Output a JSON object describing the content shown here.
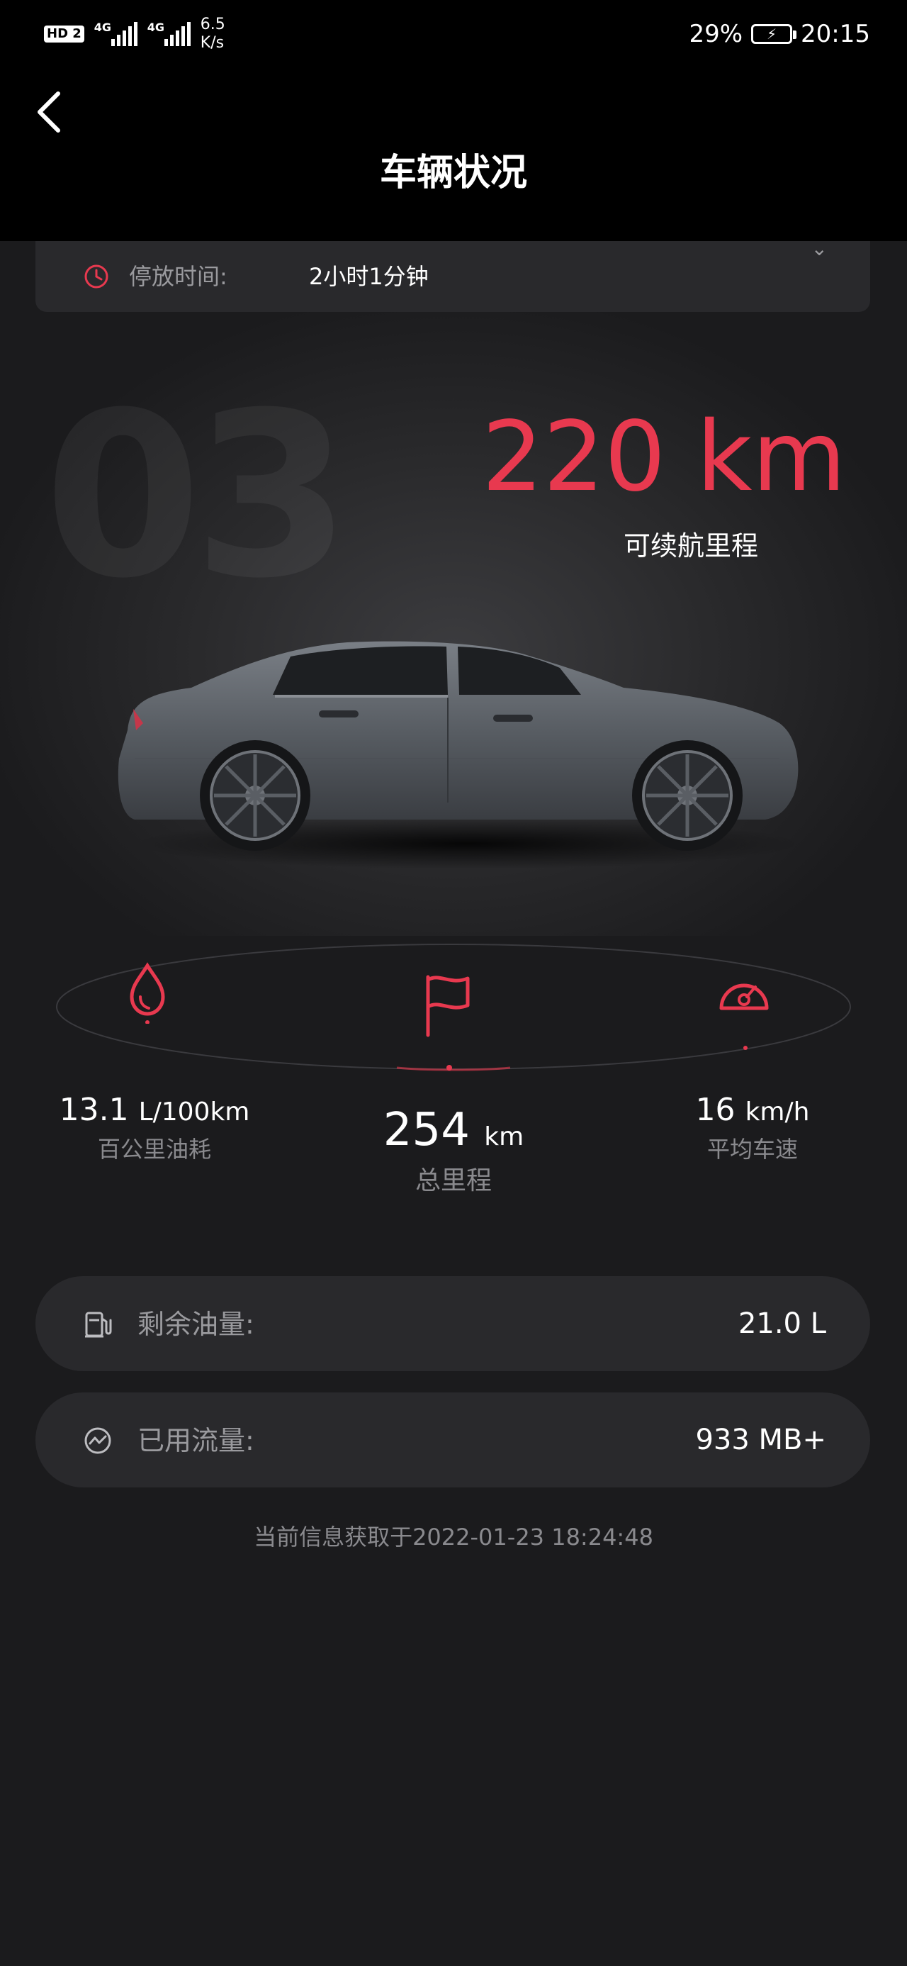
{
  "status_bar": {
    "hd_badge": "HD 2",
    "net_1": "4G",
    "net_2": "4G",
    "speed_value": "6.5",
    "speed_unit": "K/s",
    "battery_percent": "29%",
    "time": "20:15"
  },
  "header": {
    "title": "车辆状况"
  },
  "parking": {
    "label": "停放时间:",
    "value": "2小时1分钟"
  },
  "hero": {
    "model_watermark": "03",
    "range_value": "220 km",
    "range_label": "可续航里程"
  },
  "stats": {
    "fuel_consumption": {
      "value": "13.1",
      "unit": "L/100km",
      "label": "百公里油耗",
      "icon": "drop-icon"
    },
    "total_mileage": {
      "value": "254",
      "unit": "km",
      "label": "总里程",
      "icon": "flag-icon"
    },
    "avg_speed": {
      "value": "16",
      "unit": "km/h",
      "label": "平均车速",
      "icon": "speedometer-icon"
    }
  },
  "fuel": {
    "label": "剩余油量:",
    "value": "21.0 L",
    "icon": "fuel-pump-icon"
  },
  "data_usage": {
    "label": "已用流量:",
    "value": "933 MB+",
    "icon": "trend-icon"
  },
  "footer": {
    "timestamp": "当前信息获取于2022-01-23 18:24:48"
  },
  "colors": {
    "accent": "#e8394f",
    "background": "#1b1b1d",
    "card": "#29292c",
    "muted": "#9a9a9e"
  }
}
